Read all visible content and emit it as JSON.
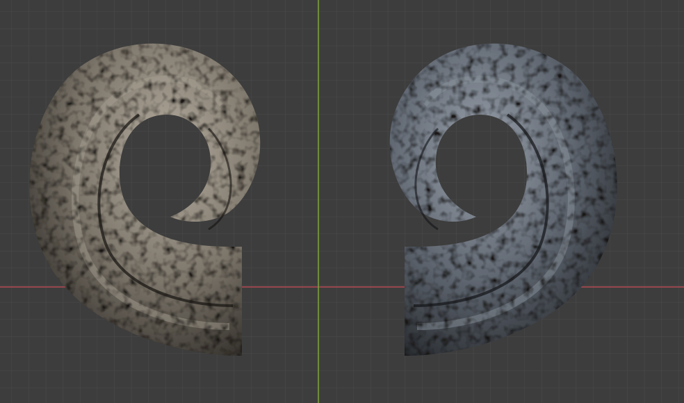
{
  "viewport": {
    "background_color": "#3d3d3d",
    "grid_color": "#4a4a4a",
    "x_axis_color": "#b54a55",
    "y_axis_color": "#7ea53c"
  },
  "scene": {
    "objects": [
      {
        "name": "left-horn",
        "material": "stone-scale",
        "tint": "#8a8478"
      },
      {
        "name": "right-horn",
        "material": "stone-scale",
        "tint": "#6f7680"
      }
    ]
  }
}
